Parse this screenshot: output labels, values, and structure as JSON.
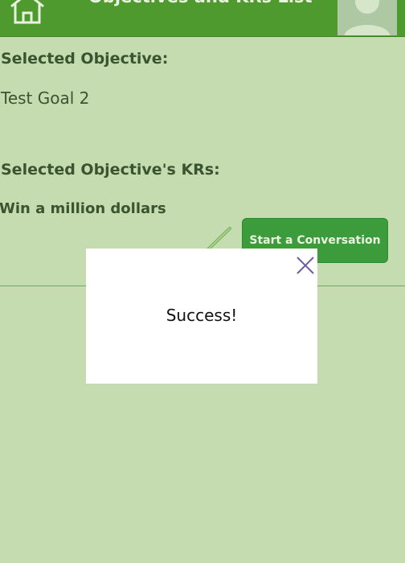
{
  "header": {
    "title": "Objectives and KRs List",
    "home_icon": "home-icon",
    "avatar_icon": "user-avatar-icon"
  },
  "objective": {
    "label": "Selected Objective:",
    "value": "Test Goal 2"
  },
  "krs": {
    "label": "Selected Objective's KRs:",
    "items": [
      "Win a million dollars"
    ]
  },
  "actions": {
    "edit_icon": "pencil-icon",
    "start_conversation_label": "Start a Conversation"
  },
  "dialog": {
    "message": "Success!",
    "close_icon": "close-icon"
  },
  "colors": {
    "background": "#c5dbb0",
    "header": "#4e9a2e",
    "button": "#3c9b3a",
    "text": "#3a5430",
    "close_icon": "#6b5aa6"
  }
}
